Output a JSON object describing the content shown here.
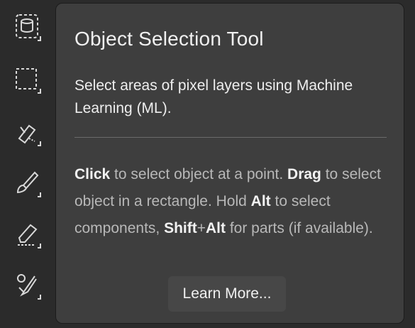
{
  "toolbar": {
    "tools": [
      {
        "name": "object-selection-tool",
        "icon": "object-selection-icon"
      },
      {
        "name": "rectangular-marquee-tool",
        "icon": "marquee-icon"
      },
      {
        "name": "remove-tool",
        "icon": "remove-tool-icon"
      },
      {
        "name": "brush-tool",
        "icon": "brush-icon"
      },
      {
        "name": "eraser-tool",
        "icon": "eraser-icon"
      },
      {
        "name": "clone-stamp-tool",
        "icon": "clone-stamp-icon"
      }
    ]
  },
  "tooltip": {
    "title": "Object Selection Tool",
    "description": "Select areas of pixel layers using Machine Learning (ML).",
    "instructions": [
      {
        "text": "Click",
        "bold": true
      },
      {
        "text": " to select object at a point. ",
        "bold": false
      },
      {
        "text": "Drag",
        "bold": true
      },
      {
        "text": " to select object in a rectangle. Hold ",
        "bold": false
      },
      {
        "text": "Alt",
        "bold": true
      },
      {
        "text": " to select components, ",
        "bold": false
      },
      {
        "text": "Shift",
        "bold": true
      },
      {
        "text": "+",
        "bold": false
      },
      {
        "text": "Alt",
        "bold": true
      },
      {
        "text": " for parts (if available).",
        "bold": false
      }
    ],
    "learn_more_label": "Learn More..."
  },
  "colors": {
    "background": "#2b2b2b",
    "tooltip_bg": "#3e3e3e",
    "button_bg": "#474747",
    "icon": "#d8d8d8"
  }
}
